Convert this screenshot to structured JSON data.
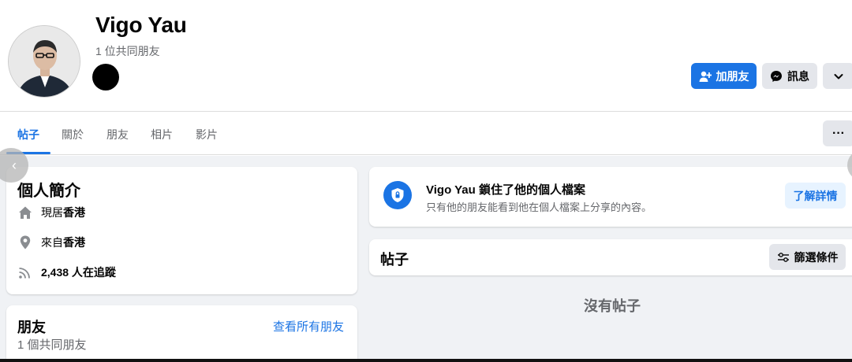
{
  "profile": {
    "name": "Vigo Yau",
    "mutual_friends": "1 位共同朋友"
  },
  "actions": {
    "add_friend": "加朋友",
    "message": "訊息"
  },
  "tabs": [
    {
      "label": "帖子",
      "active": true
    },
    {
      "label": "關於"
    },
    {
      "label": "朋友"
    },
    {
      "label": "相片"
    },
    {
      "label": "影片"
    }
  ],
  "intro": {
    "title": "個人簡介",
    "lives_prefix": "現居",
    "lives_place": "香港",
    "from_prefix": "來自",
    "from_place": "香港",
    "followers": "2,438 人在追蹤"
  },
  "friends_card": {
    "title": "朋友",
    "see_all": "查看所有朋友",
    "mutual": "1 個共同朋友"
  },
  "locked": {
    "title": "Vigo Yau 鎖住了他的個人檔案",
    "subtitle": "只有他的朋友能看到他在個人檔案上分享的內容。",
    "learn_more": "了解詳情"
  },
  "posts": {
    "title": "帖子",
    "filter": "篩選條件",
    "empty": "沒有帖子"
  },
  "colors": {
    "accent": "#1b74e4",
    "button_grey": "#e4e6eb",
    "background": "#f0f2f5"
  }
}
